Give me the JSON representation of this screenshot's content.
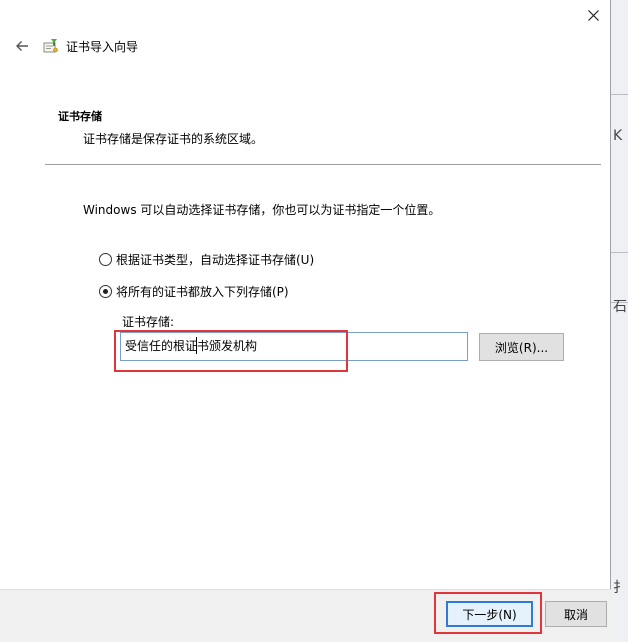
{
  "window": {
    "title": "证书导入向导",
    "close_icon": "close-icon",
    "back_icon": "back-arrow-icon",
    "title_icon": "certificate-icon"
  },
  "section": {
    "title": "证书存储",
    "description": "证书存储是保存证书的系统区域。"
  },
  "intro": "Windows 可以自动选择证书存储，你也可以为证书指定一个位置。",
  "options": [
    {
      "label": "根据证书类型，自动选择证书存储(U)",
      "selected": false
    },
    {
      "label": "将所有的证书都放入下列存储(P)",
      "selected": true
    }
  ],
  "store": {
    "label": "证书存储:",
    "value": "受信任的根证书颁发机构",
    "browse_label": "浏览(R)..."
  },
  "footer": {
    "next_label": "下一步(N)",
    "cancel_label": "取消"
  },
  "background_glyphs": [
    "K",
    "石",
    "扌"
  ],
  "colors": {
    "highlight": "#e0353b",
    "focus_border": "#2f7ad6",
    "input_border": "#7a9ec9"
  }
}
